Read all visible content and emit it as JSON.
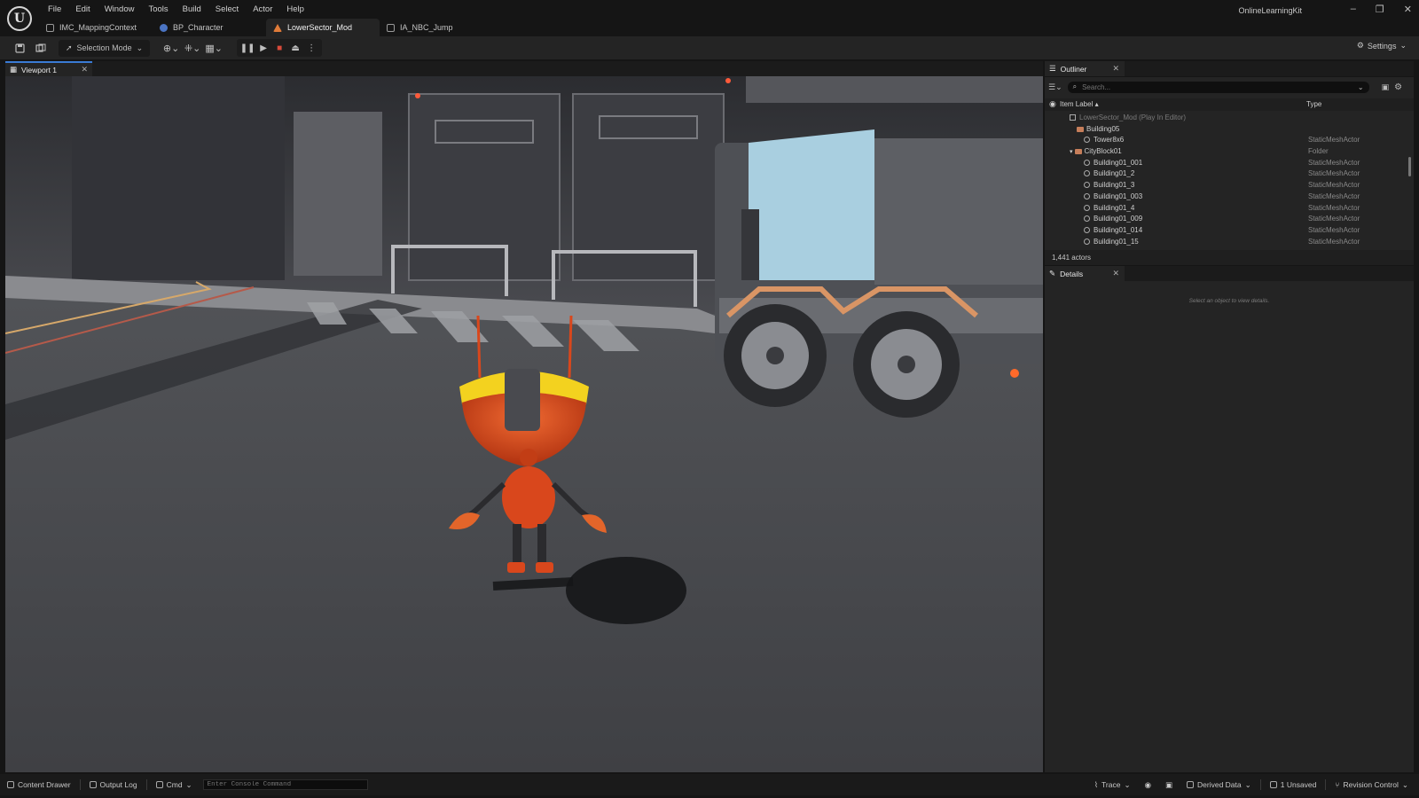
{
  "app": {
    "project_name": "OnlineLearningKit",
    "logo_letter": "U"
  },
  "menu": [
    "File",
    "Edit",
    "Window",
    "Tools",
    "Build",
    "Select",
    "Actor",
    "Help"
  ],
  "window_controls": {
    "minimize": "–",
    "restore": "❐",
    "close": "✕"
  },
  "tabs": [
    {
      "label": "IMC_MappingContext",
      "icon": "input-mapping-icon"
    },
    {
      "label": "BP_Character",
      "icon": "blueprint-icon"
    },
    {
      "label": "LowerSector_Mod",
      "icon": "level-icon",
      "active": true
    },
    {
      "label": "IA_NBC_Jump",
      "icon": "input-action-icon"
    }
  ],
  "toolbar": {
    "mode_label": "Selection Mode",
    "settings_label": "Settings"
  },
  "viewport": {
    "tab_label": "Viewport 1"
  },
  "outliner": {
    "tab_label": "Outliner",
    "search_placeholder": "Search...",
    "col_label": "Item Label ▴",
    "col_type": "Type",
    "rows": [
      {
        "name": "LowerSector_Mod (Play In Editor)",
        "type": "",
        "indent": 1,
        "icon": "level",
        "dim": true
      },
      {
        "name": "Building05",
        "type": "",
        "indent": 2,
        "icon": "folder"
      },
      {
        "name": "Tower8x6",
        "type": "StaticMeshActor",
        "indent": 3,
        "icon": "mesh"
      },
      {
        "name": "CityBlock01",
        "type": "Folder",
        "indent": 2,
        "icon": "folder"
      },
      {
        "name": "Building01_001",
        "type": "StaticMeshActor",
        "indent": 3,
        "icon": "mesh"
      },
      {
        "name": "Building01_2",
        "type": "StaticMeshActor",
        "indent": 3,
        "icon": "mesh"
      },
      {
        "name": "Building01_3",
        "type": "StaticMeshActor",
        "indent": 3,
        "icon": "mesh"
      },
      {
        "name": "Building01_003",
        "type": "StaticMeshActor",
        "indent": 3,
        "icon": "mesh"
      },
      {
        "name": "Building01_4",
        "type": "StaticMeshActor",
        "indent": 3,
        "icon": "mesh"
      },
      {
        "name": "Building01_009",
        "type": "StaticMeshActor",
        "indent": 3,
        "icon": "mesh"
      },
      {
        "name": "Building01_014",
        "type": "StaticMeshActor",
        "indent": 3,
        "icon": "mesh"
      },
      {
        "name": "Building01_15",
        "type": "StaticMeshActor",
        "indent": 3,
        "icon": "mesh"
      }
    ],
    "actor_count": "1,441 actors"
  },
  "details": {
    "tab_label": "Details",
    "empty_message": "Select an object to view details."
  },
  "statusbar": {
    "content_drawer": "Content Drawer",
    "output_log": "Output Log",
    "cmd": "Cmd",
    "console_placeholder": "Enter Console Command",
    "trace": "Trace",
    "derived_data": "Derived Data",
    "unsaved": "1 Unsaved",
    "revision_control": "Revision Control"
  },
  "colors": {
    "accent": "#3a7bd5",
    "panel_bg": "#242424",
    "robot_orange": "#d9471c",
    "robot_yellow": "#f3d21f",
    "truck_blue": "#a9cfe0"
  }
}
